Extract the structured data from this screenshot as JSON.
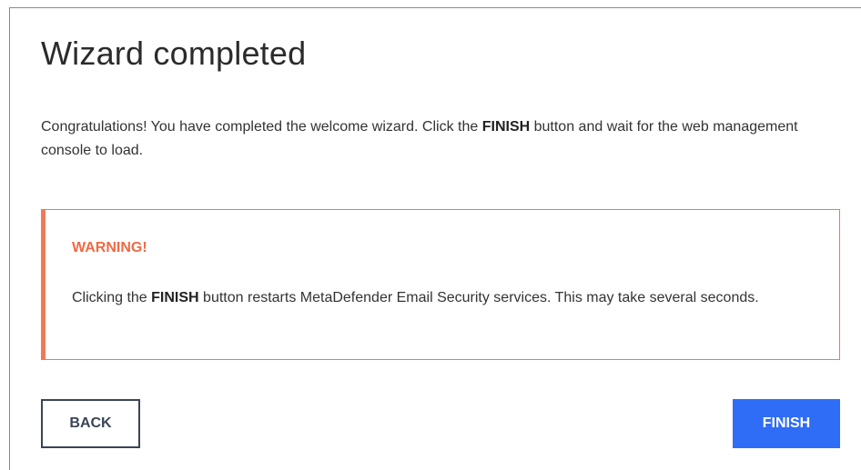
{
  "page": {
    "title": "Wizard completed"
  },
  "intro": {
    "part1": "Congratulations! You have completed the welcome wizard. Click the ",
    "emphasis": "FINISH",
    "part2": " button and wait for the web management console to load."
  },
  "warning": {
    "title": "WARNING!",
    "part1": "Clicking the ",
    "emphasis": "FINISH",
    "part2": " button restarts MetaDefender Email Security services. This may take several seconds.",
    "accent_color": "#ef6a45"
  },
  "buttons": {
    "back_label": "BACK",
    "finish_label": "FINISH",
    "primary_color": "#2f6df6"
  }
}
